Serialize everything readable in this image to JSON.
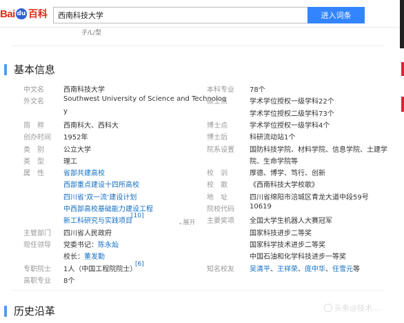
{
  "search": {
    "query": "西南科技大学",
    "button_label": "进入词条"
  },
  "logo": {
    "bai": "Bai",
    "paw": "du",
    "baike": "百科"
  },
  "ghost_text": "子/L/型",
  "sections": {
    "basic_info": "基本信息",
    "history": "历史沿革"
  },
  "left": [
    {
      "label": "中文名",
      "value": "西南科技大学"
    },
    {
      "label": "外文名",
      "value": "Southwest University of Science and Technolog"
    },
    {
      "label": "",
      "value": "y"
    },
    {
      "label": "简　称",
      "value": "西南科大、西科大"
    },
    {
      "label": "创办时间",
      "value": "1952年"
    },
    {
      "label": "类　别",
      "value": "公立大学"
    },
    {
      "label": "类　型",
      "value": "理工"
    },
    {
      "label": "属　性",
      "value": "省部共建高校"
    },
    {
      "label": "",
      "value": "西部重点建设十四所高校"
    },
    {
      "label": "",
      "value": "四川省‘双一流’建设计划"
    },
    {
      "label": "",
      "value": "中西部高校基础能力建设工程"
    },
    {
      "label": "",
      "value": "新工科研究与实践项目"
    },
    {
      "label": "主管部门",
      "value": "四川省人民政府"
    },
    {
      "label": "现任领导",
      "value": "党委书记：陈永灿"
    },
    {
      "label": "",
      "value": "校长：董发勤"
    },
    {
      "label": "专职院士",
      "value": "1人（中国工程院院士）"
    },
    {
      "label": "高职专业",
      "value": "8个"
    }
  ],
  "left_sup": {
    "newengineering": "[10]",
    "academician": "[6]"
  },
  "leaders": {
    "secretary_prefix": "党委书记：",
    "secretary": "陈永灿",
    "president_prefix": "校长：",
    "president": "董发勤"
  },
  "expand_label": "展开",
  "right": [
    {
      "label": "本科专业",
      "value": "78个"
    },
    {
      "label": "硕士点",
      "value": "学术学位授权一级学科22个"
    },
    {
      "label": "",
      "value": "学术学位授权二级学科73个"
    },
    {
      "label": "博士点",
      "value": "学术学位授权一级学科4个"
    },
    {
      "label": "博士后",
      "value": "科研流动站1个"
    },
    {
      "label": "院系设置",
      "value": "国防科技学院、材料学院、信息学院、土建学"
    },
    {
      "label": "",
      "value": "院、生命学院等"
    },
    {
      "label": "校　训",
      "value": "厚德、博学、笃行、创新"
    },
    {
      "label": "校　歌",
      "value": "《西南科技大学校歌》"
    },
    {
      "label": "地　址",
      "value": "四川省绵阳市涪城区青龙大道中段59号"
    },
    {
      "label": "院校代码",
      "value": "10619"
    },
    {
      "label": "主要奖项",
      "value": "全国大学生机器人大赛冠军"
    },
    {
      "label": "",
      "value": "国家科技进步二等奖"
    },
    {
      "label": "",
      "value": "国家科学技术进步二等奖"
    },
    {
      "label": "",
      "value": "中国石油和化学科技进步一等奖"
    },
    {
      "label": "知名校友",
      "value": "吴清平、王祥荣、庞中华、任雪元等"
    }
  ],
  "alumni": {
    "names": [
      "吴清平",
      "王祥荣",
      "庞中华",
      "任雪元"
    ],
    "sep": "、",
    "suffix": "等"
  },
  "watermark": "头条@技术..."
}
